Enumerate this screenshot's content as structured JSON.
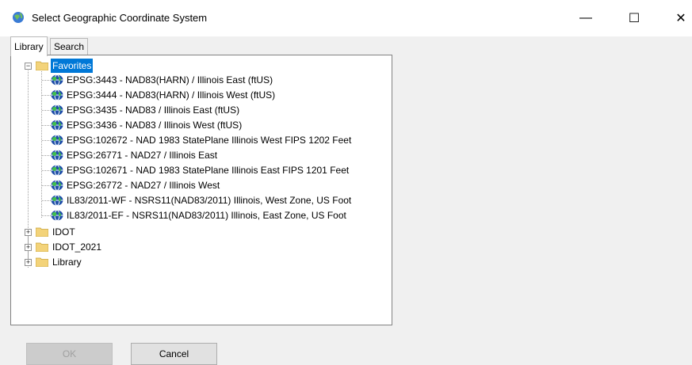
{
  "window": {
    "title": "Select Geographic Coordinate System",
    "minimize": "—",
    "maximize": "☐",
    "close": "✕"
  },
  "tabs": [
    {
      "label": "Library",
      "active": true
    },
    {
      "label": "Search",
      "active": false
    }
  ],
  "tree": {
    "favorites": {
      "label": "Favorites",
      "expanded": true,
      "items": [
        "EPSG:3443 - NAD83(HARN) / Illinois East (ftUS)",
        "EPSG:3444 - NAD83(HARN) / Illinois West (ftUS)",
        "EPSG:3435 - NAD83 / Illinois East (ftUS)",
        "EPSG:3436 - NAD83 / Illinois West (ftUS)",
        "EPSG:102672 - NAD 1983 StatePlane Illinois West FIPS 1202 Feet",
        "EPSG:26771 - NAD27 / Illinois East",
        "EPSG:102671 - NAD 1983 StatePlane Illinois East FIPS 1201 Feet",
        "EPSG:26772 - NAD27 / Illinois West",
        "IL83/2011-WF - NSRS11(NAD83/2011) Illinois, West Zone, US Foot",
        "IL83/2011-EF - NSRS11(NAD83/2011) Illinois, East Zone, US Foot"
      ]
    },
    "folders": [
      "IDOT",
      "IDOT_2021",
      "Library"
    ]
  },
  "buttons": {
    "ok": "OK",
    "cancel": "Cancel"
  },
  "icons": {
    "app": "globe-app-icon",
    "folder": "folder-icon",
    "crs": "globe-icon"
  },
  "colors": {
    "selection": "#0078d7",
    "folder": "#f3d37a"
  }
}
